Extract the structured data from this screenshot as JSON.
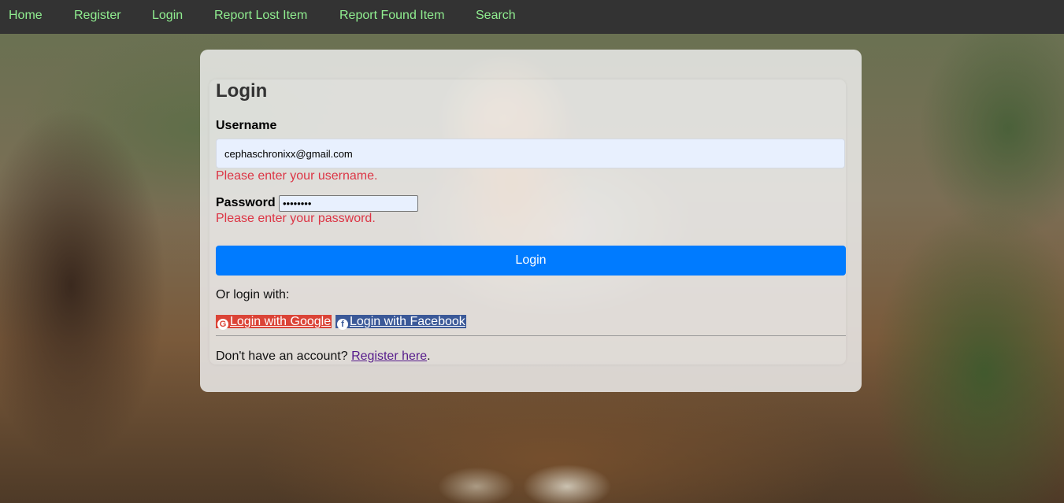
{
  "nav": {
    "items": [
      {
        "label": "Home"
      },
      {
        "label": "Register"
      },
      {
        "label": "Login"
      },
      {
        "label": "Report Lost Item"
      },
      {
        "label": "Report Found Item"
      },
      {
        "label": "Search"
      }
    ]
  },
  "form": {
    "title": "Login",
    "username_label": "Username",
    "username_value": "cephaschronixx@gmail.com",
    "username_error": "Please enter your username.",
    "password_label": "Password",
    "password_value": "••••••••",
    "password_error": "Please enter your password.",
    "submit_label": "Login",
    "or_login_with": "Or login with:",
    "google_label": "Login with Google",
    "facebook_label": "Login with Facebook",
    "no_account_text": "Don't have an account?",
    "register_link": "Register here",
    "register_suffix": "."
  },
  "colors": {
    "nav_bg": "#333333",
    "nav_link": "#90ee90",
    "primary": "#007bff",
    "error": "#dc3545",
    "google": "#db4437",
    "facebook": "#3b5998"
  },
  "icons": {
    "google": "google-icon",
    "facebook": "facebook-icon"
  }
}
